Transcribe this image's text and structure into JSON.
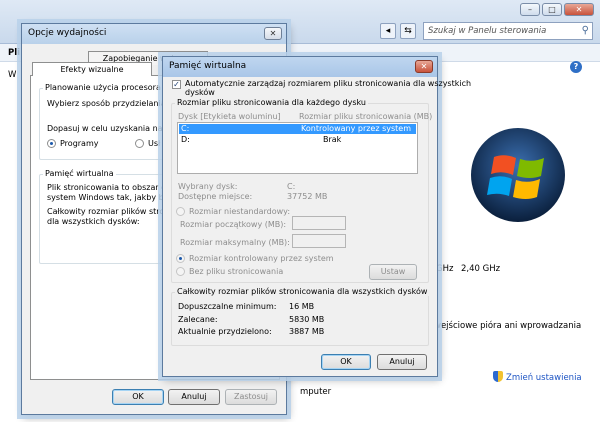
{
  "control_panel": {
    "search_placeholder": "Szukaj w Panelu sterowania",
    "nav_back": "◂",
    "nav_refresh": "⇆",
    "window_buttons": {
      "minimize": "–",
      "maximize": "□",
      "close": "✕"
    },
    "help": "?",
    "partial_menu": "Pli",
    "partial_side": "W",
    "cpu_speed_partial": "GHz",
    "cpu_speed": "2,40 GHz",
    "pen_text": "wejściowe pióra ani wprowadzania",
    "change_settings_link": "Zmień ustawienia",
    "computer_partial": "mputer"
  },
  "perf_dialog": {
    "title": "Opcje wydajności",
    "close": "✕",
    "tabs": [
      "Efekty wizualne",
      "Zapobieganie wykon..."
    ],
    "cpu_group": {
      "label": "Planowanie użycia procesora",
      "desc": "Wybierz sposób przydzielania zas",
      "adjust": "Dopasuj w celu uzyskania najlepsz",
      "programs": "Programy",
      "services_partial": "Usł"
    },
    "vm_group": {
      "label": "Pamięć wirtualna",
      "line1": "Plik stronicowania to obszar dysk",
      "line2": "system Windows tak, jakby była",
      "line3": "Całkowity rozmiar plików stronico",
      "line4": "dla wszystkich dysków:"
    },
    "ok": "OK",
    "cancel": "Anuluj",
    "apply": "Zastosuj"
  },
  "vm_dialog": {
    "title": "Pamięć wirtualna",
    "close": "✕",
    "auto_manage": "Automatycznie zarządzaj rozmiarem pliku stronicowania dla wszystkich",
    "auto_manage_2": "dysków",
    "per_drive_group": "Rozmiar pliku stronicowania dla każdego dysku",
    "col_drive": "Dysk [Etykieta woluminu]",
    "col_size": "Rozmiar pliku stronicowania (MB)",
    "drives": [
      {
        "drive": "C:",
        "size": "Kontrolowany przez system"
      },
      {
        "drive": "D:",
        "size": "Brak"
      }
    ],
    "selected_drive_label": "Wybrany dysk:",
    "selected_drive_value": "C:",
    "free_space_label": "Dostępne miejsce:",
    "free_space_value": "37752 MB",
    "custom_size": "Rozmiar niestandardowy:",
    "initial_size": "Rozmiar początkowy (MB):",
    "max_size": "Rozmiar maksymalny (MB):",
    "system_managed": "Rozmiar kontrolowany przez system",
    "no_paging": "Bez pliku stronicowania",
    "set_button": "Ustaw",
    "total_group": "Całkowity rozmiar plików stronicowania dla wszystkich dysków",
    "min_label": "Dopuszczalne minimum:",
    "min_value": "16 MB",
    "recommended_label": "Zalecane:",
    "recommended_value": "5830 MB",
    "current_label": "Aktualnie przydzielono:",
    "current_value": "3887 MB",
    "ok": "OK",
    "cancel": "Anuluj"
  }
}
